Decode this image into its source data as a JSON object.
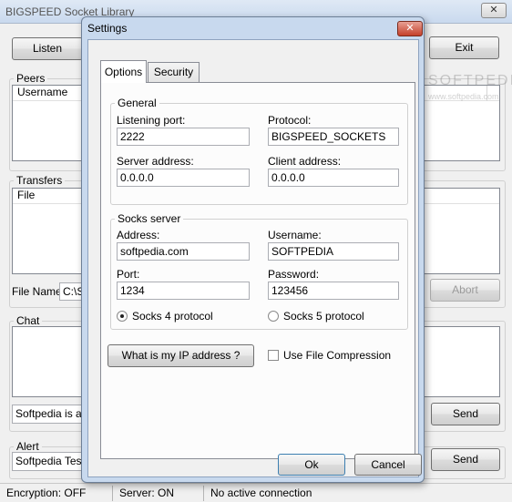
{
  "main_window": {
    "title": "BIGSPEED Socket Library",
    "close_glyph": "✕",
    "listen_button": "Listen",
    "exit_button": "Exit",
    "peers": {
      "label": "Peers",
      "column": "Username"
    },
    "transfers": {
      "label": "Transfers",
      "column": "File"
    },
    "file_name": {
      "label": "File Name:",
      "value": "C:\\S"
    },
    "abort_button": "Abort",
    "chat": {
      "label": "Chat",
      "input_value": "Softpedia is a lib",
      "send_button": "Send"
    },
    "alert": {
      "label": "Alert",
      "input_value": "Softpedia Test",
      "send_button": "Send"
    },
    "watermark": "SOFTPEDIA",
    "watermark_url": "www.softpedia.com"
  },
  "status_bar": {
    "encryption": "Encryption: OFF",
    "server": "Server: ON",
    "connection": "No active connection"
  },
  "dialog": {
    "title": "Settings",
    "close_glyph": "✕",
    "tabs": [
      {
        "label": "Options"
      },
      {
        "label": "Security"
      }
    ],
    "general": {
      "label": "General",
      "listening_port_label": "Listening port:",
      "listening_port_value": "2222",
      "protocol_label": "Protocol:",
      "protocol_value": "BIGSPEED_SOCKETS",
      "server_address_label": "Server address:",
      "server_address_value": "0.0.0.0",
      "client_address_label": "Client address:",
      "client_address_value": "0.0.0.0"
    },
    "socks": {
      "label": "Socks server",
      "address_label": "Address:",
      "address_value": "softpedia.com",
      "username_label": "Username:",
      "username_value": "SOFTPEDIA",
      "port_label": "Port:",
      "port_value": "1234",
      "password_label": "Password:",
      "password_value": "123456",
      "socks4_label": "Socks 4 protocol",
      "socks5_label": "Socks 5 protocol",
      "selected": "socks4"
    },
    "ip_button": "What is my IP address ?",
    "compression_label": "Use File Compression",
    "compression_checked": false,
    "ok_button": "Ok",
    "cancel_button": "Cancel"
  },
  "colors": {
    "title_bar": "#c9d9ee",
    "dialog_frame": "#c8d9ee",
    "window_bg": "#f0f0f0"
  }
}
